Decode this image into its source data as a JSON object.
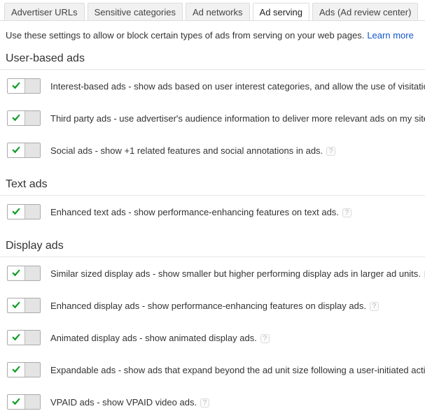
{
  "tabs": [
    {
      "label": "Advertiser URLs",
      "active": false
    },
    {
      "label": "Sensitive categories",
      "active": false
    },
    {
      "label": "Ad networks",
      "active": false
    },
    {
      "label": "Ad serving",
      "active": true
    },
    {
      "label": "Ads (Ad review center)",
      "active": false
    }
  ],
  "intro": {
    "text": "Use these settings to allow or block certain types of ads from serving on your web pages.",
    "link_label": "Learn more"
  },
  "help_glyph": "?",
  "check_color": "#0f9d27",
  "link_color": "#1155cc",
  "sections": [
    {
      "title": "User-based ads",
      "rows": [
        {
          "label": "Interest-based ads - show ads based on user interest categories, and allow the use of visitation",
          "enabled": true,
          "has_help": false
        },
        {
          "label": "Third party ads - use advertiser's audience information to deliver more relevant ads on my sites.",
          "enabled": true,
          "has_help": false
        },
        {
          "label": "Social ads - show +1 related features and social annotations in ads.",
          "enabled": true,
          "has_help": true
        }
      ]
    },
    {
      "title": "Text ads",
      "rows": [
        {
          "label": "Enhanced text ads - show performance-enhancing features on text ads.",
          "enabled": true,
          "has_help": true
        }
      ]
    },
    {
      "title": "Display ads",
      "rows": [
        {
          "label": "Similar sized display ads - show smaller but higher performing display ads in larger ad units.",
          "enabled": true,
          "has_help": true
        },
        {
          "label": "Enhanced display ads - show performance-enhancing features on display ads.",
          "enabled": true,
          "has_help": true
        },
        {
          "label": "Animated display ads - show animated display ads.",
          "enabled": true,
          "has_help": true
        },
        {
          "label": "Expandable ads - show ads that expand beyond the ad unit size following a user-initiated action",
          "enabled": true,
          "has_help": false
        },
        {
          "label": "VPAID ads - show VPAID video ads.",
          "enabled": true,
          "has_help": true
        }
      ]
    }
  ]
}
